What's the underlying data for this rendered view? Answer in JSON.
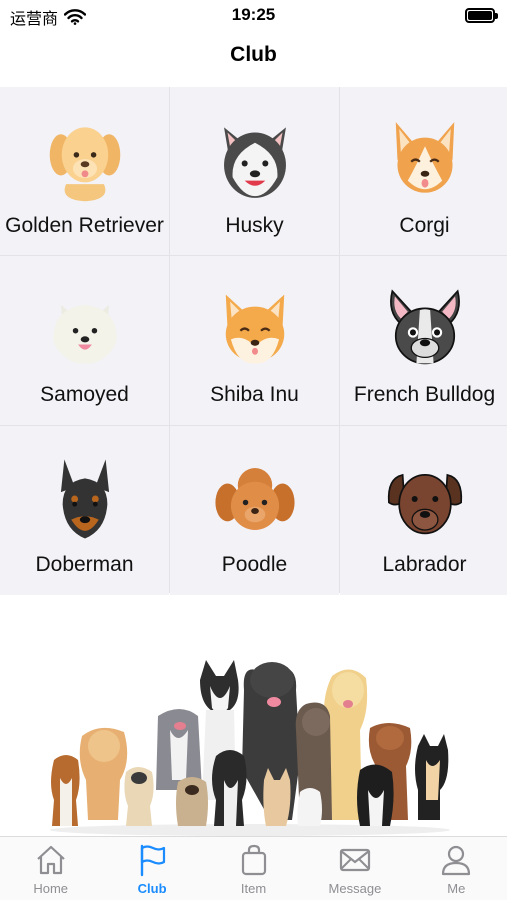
{
  "status_bar": {
    "carrier": "运营商",
    "time": "19:25"
  },
  "nav": {
    "title": "Club"
  },
  "breeds": [
    {
      "label": "Golden Retriever",
      "icon": "golden-retriever-icon"
    },
    {
      "label": "Husky",
      "icon": "husky-icon"
    },
    {
      "label": "Corgi",
      "icon": "corgi-icon"
    },
    {
      "label": "Samoyed",
      "icon": "samoyed-icon"
    },
    {
      "label": "Shiba Inu",
      "icon": "shiba-inu-icon"
    },
    {
      "label": "French Bulldog",
      "icon": "french-bulldog-icon"
    },
    {
      "label": "Doberman",
      "icon": "doberman-icon"
    },
    {
      "label": "Poodle",
      "icon": "poodle-icon"
    },
    {
      "label": "Labrador",
      "icon": "labrador-icon"
    }
  ],
  "tabs": [
    {
      "label": "Home",
      "icon": "home-icon",
      "active": false
    },
    {
      "label": "Club",
      "icon": "flag-icon",
      "active": true
    },
    {
      "label": "Item",
      "icon": "bag-icon",
      "active": false
    },
    {
      "label": "Message",
      "icon": "envelope-icon",
      "active": false
    },
    {
      "label": "Me",
      "icon": "person-icon",
      "active": false
    }
  ],
  "colors": {
    "accent": "#1a8cff",
    "inactive": "#8e8e93",
    "grid_bg": "#f2f2f7"
  }
}
